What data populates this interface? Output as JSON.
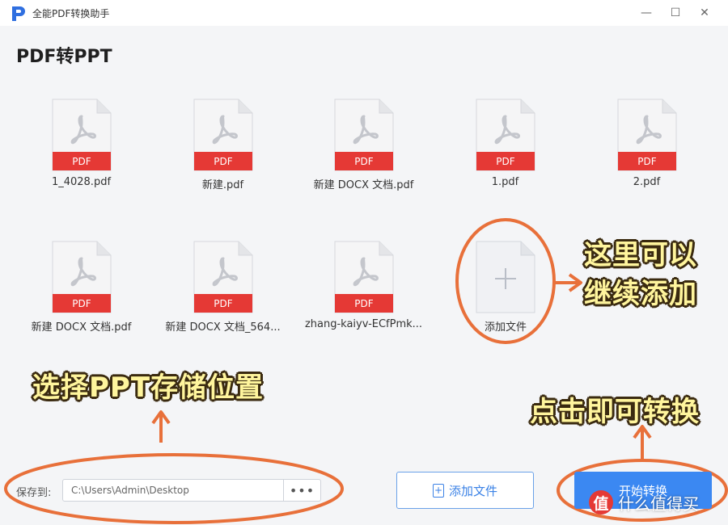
{
  "window": {
    "title": "全能PDF转换助手",
    "controls": {
      "minimize": "—",
      "maximize": "☐",
      "close": "✕"
    }
  },
  "page": {
    "title": "PDF转PPT"
  },
  "files": [
    {
      "name": "1_4028.pdf",
      "badge": "PDF"
    },
    {
      "name": "新建.pdf",
      "badge": "PDF"
    },
    {
      "name": "新建 DOCX 文档.pdf",
      "badge": "PDF"
    },
    {
      "name": "1.pdf",
      "badge": "PDF"
    },
    {
      "name": "2.pdf",
      "badge": "PDF"
    },
    {
      "name": "新建 DOCX 文档.pdf",
      "badge": "PDF"
    },
    {
      "name": "新建 DOCX 文档_564...",
      "badge": "PDF"
    },
    {
      "name": "zhang-kaiyv-ECfPmk...",
      "badge": "PDF"
    }
  ],
  "add_tile": {
    "label": "添加文件",
    "icon": "plus-icon"
  },
  "annotations": {
    "add_more_line1": "这里可以",
    "add_more_line2": "继续添加",
    "choose_location": "选择PPT存储位置",
    "click_convert": "点击即可转换"
  },
  "bottom": {
    "save_label": "保存到:",
    "save_path": "C:\\Users\\Admin\\Desktop",
    "more_button": "•••",
    "add_button": "添加文件",
    "start_button": "开始转换"
  },
  "watermark": {
    "badge": "值",
    "text": "什么值得买"
  },
  "colors": {
    "accent": "#3b88f2",
    "pdf_badge": "#e53935",
    "annotation_circle": "#e8703a",
    "annotation_text": "#fff59d"
  }
}
